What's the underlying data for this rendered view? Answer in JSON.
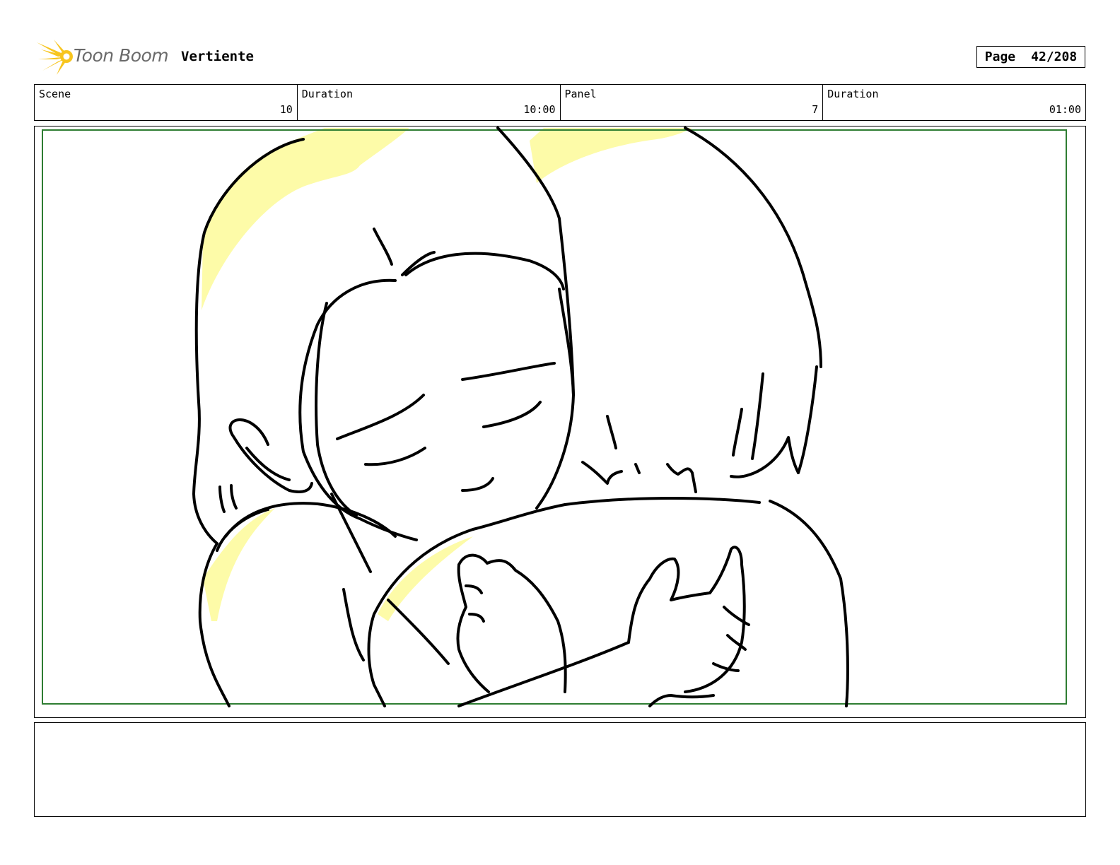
{
  "header": {
    "logo_text": "Toon Boom",
    "project_title": "Vertiente",
    "page_label": "Page",
    "page_number": "42/208"
  },
  "info": {
    "scene_label": "Scene",
    "scene_value": "10",
    "scene_duration_label": "Duration",
    "scene_duration_value": "10:00",
    "panel_label": "Panel",
    "panel_value": "7",
    "panel_duration_label": "Duration",
    "panel_duration_value": "01:00"
  },
  "colors": {
    "safe_frame": "#2e7d32",
    "highlight": "#fdfba8",
    "logo_accent": "#f7c51e"
  },
  "notes": {
    "text": ""
  }
}
